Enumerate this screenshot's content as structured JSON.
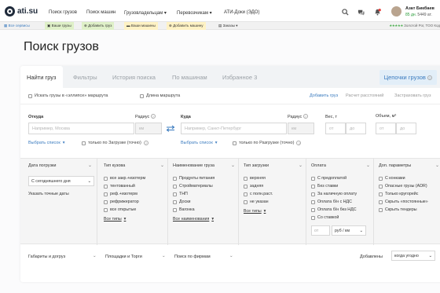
{
  "header": {
    "logo_text": "ati.su",
    "nav": [
      "Поиск грузов",
      "Поиск машин",
      "Грузовладельцам ▾",
      "Перевозчикам ▾",
      "АТИ-Доки (ЭДО)"
    ],
    "user_name": "Азат Бикбаев",
    "user_balance": "85 дн.",
    "user_balance_rub": "5449 ат."
  },
  "services_bar": {
    "all_services": "Все сервисы",
    "items": [
      "Ваши грузы",
      "Добавить груз",
      "Ваши машины",
      "Добавить машину",
      "Заказы ▾"
    ],
    "rating_stars": "★★★★★",
    "rating_text": "Золотой Рог, ТОО Код"
  },
  "page": {
    "title": "Поиск грузов"
  },
  "tabs": {
    "items": [
      "Найти груз",
      "Фильтры",
      "История поиска",
      "По машинам",
      "Избранное 3"
    ],
    "chains": "Цепочки грузов"
  },
  "options": {
    "ellipse": "Искать грузы в «эллипсе» маршрута",
    "route_length": "Длина маршрута",
    "add_cargo": "Добавить груз",
    "distance_calc": "Расчет расстояний",
    "book_cargo": "Застраховать груз"
  },
  "route": {
    "from_label": "Откуда",
    "from_placeholder": "Например, Москва",
    "radius_label": "Радиус",
    "radius_unit": "км",
    "to_label": "Куда",
    "to_placeholder": "Например, Санкт-Петербург",
    "weight_label": "Вес, т",
    "volume_label": "Объем, м³",
    "from_placeholder_min": "от",
    "to_placeholder_max": "до",
    "select_list": "Выбрать список",
    "only_loading": "только по Загрузке (точно)",
    "only_unloading": "только по Разгрузке (точно)"
  },
  "filters": {
    "date": {
      "title": "Дата погрузки",
      "value": "С сегодняшнего дня",
      "exact": "Указать точные даты"
    },
    "body_type": {
      "title": "Тип кузова",
      "items": [
        "все закр.+изотерм",
        "тентованный",
        "реф.+изотерм",
        "рефрижератор",
        "все открытые"
      ],
      "all": "Все типы"
    },
    "cargo_name": {
      "title": "Наименование груза",
      "items": [
        "Продукты питания",
        "Стройматериалы",
        "ТНП",
        "Доски",
        "Вагонка"
      ],
      "all": "Все наименования"
    },
    "load_type": {
      "title": "Тип загрузки",
      "items": [
        "верхняя",
        "задняя",
        "с полн.раст.",
        "не указан"
      ],
      "all": "Все типы"
    },
    "payment": {
      "title": "Оплата",
      "items": [
        "С предоплатой",
        "Без ставки",
        "За наличную оплату",
        "Оплата б/н с НДС",
        "Оплата б/н без НДС",
        "Со ставкой"
      ],
      "rate_from": "от",
      "rate_unit": "руб / км"
    },
    "extra": {
      "title": "Доп. параметры",
      "items": [
        "С конками",
        "Опасные грузы (ADR)",
        "Только кругорейс",
        "Скрыть «постоянные»",
        "Скрыть тендеры"
      ]
    }
  },
  "bottom": {
    "dims": "Габариты и догруз",
    "platforms": "Площадки и Торги",
    "firms": "Поиск по фирмам",
    "added_label": "Добавлены",
    "added_value": "когда угодно"
  }
}
